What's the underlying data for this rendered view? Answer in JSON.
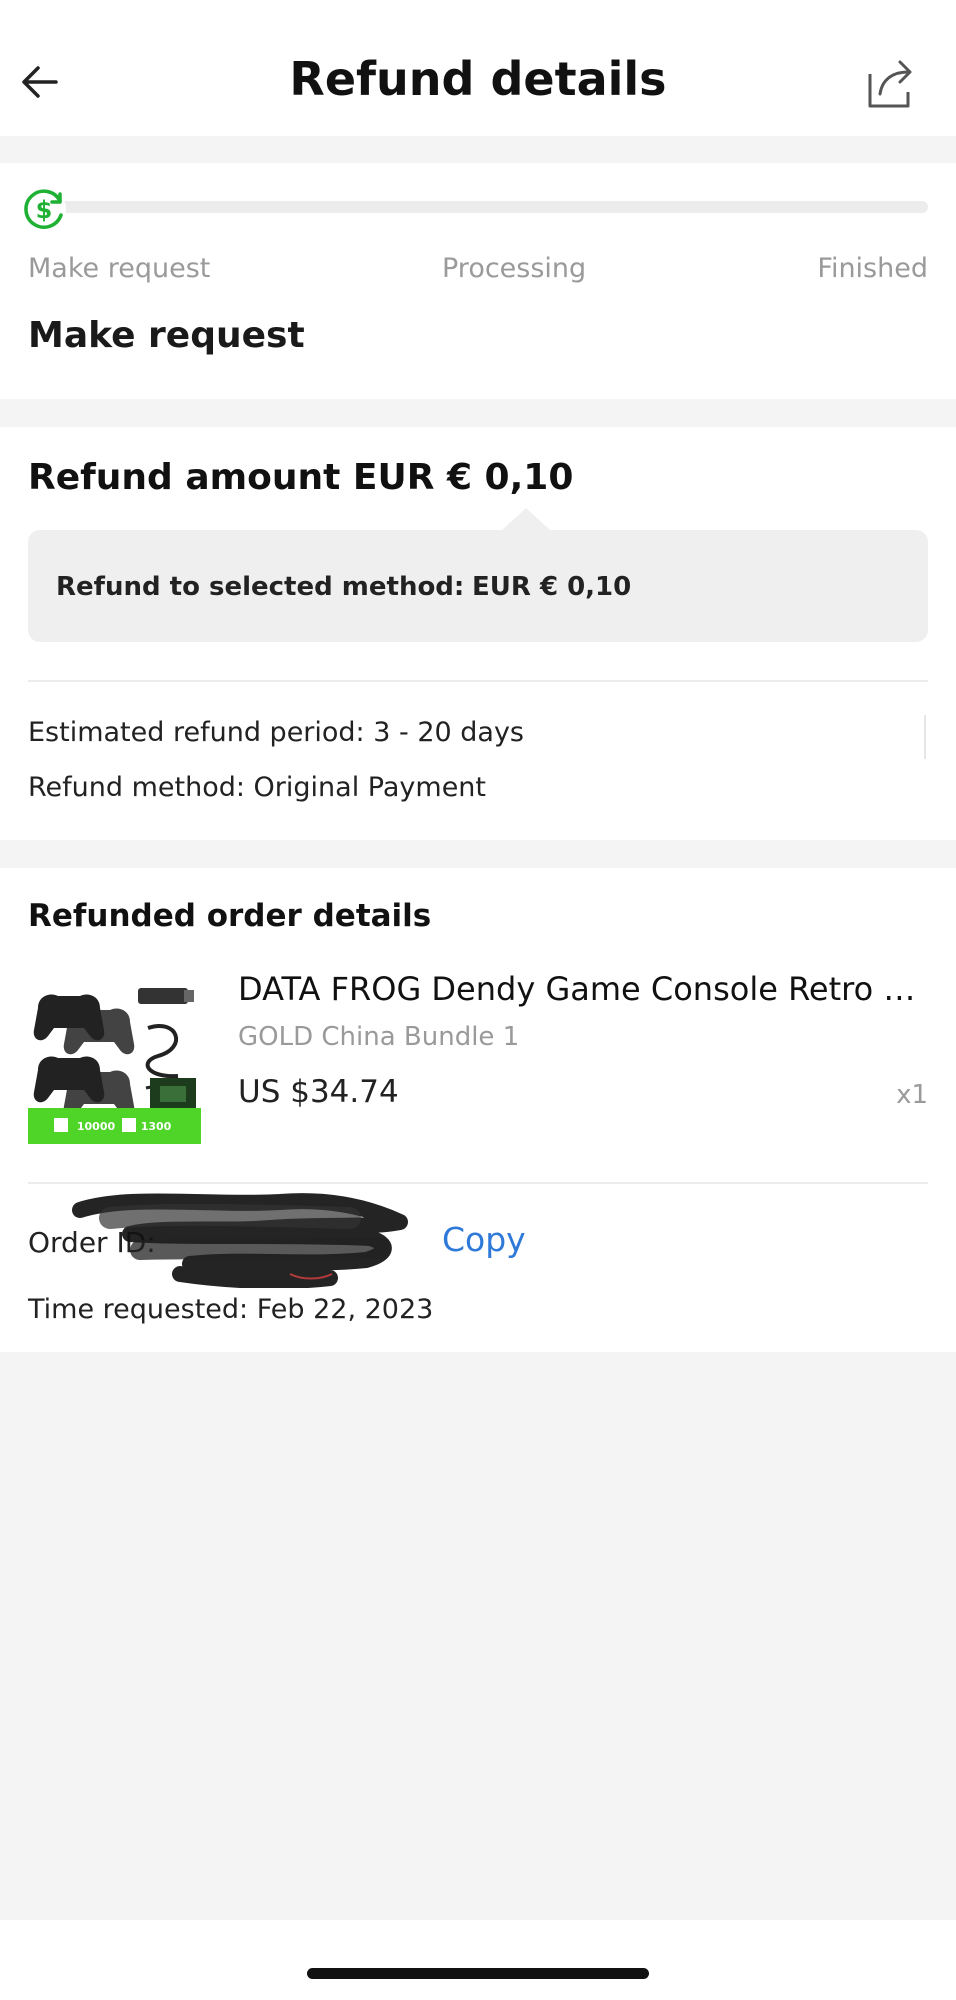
{
  "header": {
    "title": "Refund details",
    "back_icon": "arrow-left-icon",
    "share_icon": "share-icon"
  },
  "progress": {
    "steps": [
      "Make request",
      "Processing",
      "Finished"
    ],
    "current_step": "Make request",
    "progress_fraction": 0.0,
    "icon": "refund-dollar-icon",
    "accent_color": "#1fb133"
  },
  "refund": {
    "amount_title": "Refund amount EUR € 0,10",
    "method_label": "Refund to selected method:",
    "method_value": "EUR € 0,10",
    "period": "Estimated refund period: 3 - 20 days",
    "method": "Refund method: Original Payment"
  },
  "order": {
    "section_title": "Refunded order details",
    "product": {
      "name": "DATA FROG Dendy Game Console Retro Vid...",
      "variant": "GOLD China Bundle 1",
      "price": "US $34.74",
      "quantity": "x1",
      "badge_left": "10000",
      "badge_right": "1300"
    },
    "order_id_label": "Order ID:",
    "copy_label": "Copy",
    "time_requested": "Time requested: Feb 22, 2023",
    "link_color": "#2f7ad9"
  }
}
